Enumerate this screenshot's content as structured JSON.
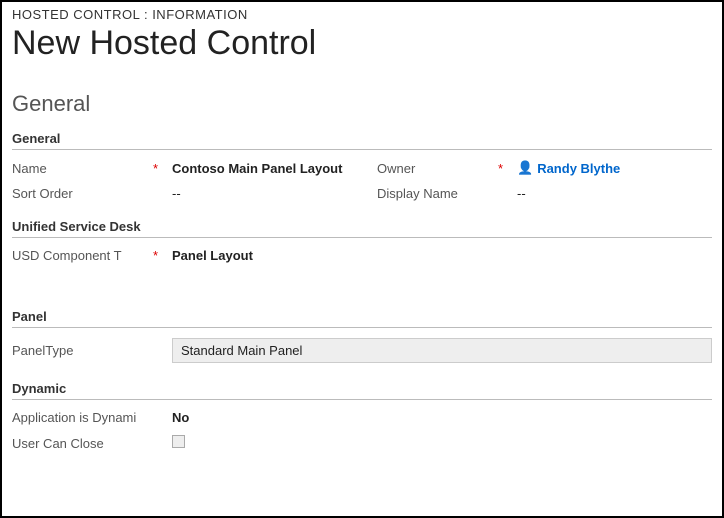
{
  "breadcrumb": "HOSTED CONTROL : INFORMATION",
  "pageTitle": "New Hosted Control",
  "sectionTitle": "General",
  "subsections": {
    "general": "General",
    "usd": "Unified Service Desk",
    "panel": "Panel",
    "dynamic": "Dynamic"
  },
  "fields": {
    "name": {
      "label": "Name",
      "required": "*",
      "value": "Contoso Main Panel Layout"
    },
    "owner": {
      "label": "Owner",
      "required": "*",
      "value": "Randy Blythe"
    },
    "sortOrder": {
      "label": "Sort Order",
      "value": "--"
    },
    "displayName": {
      "label": "Display Name",
      "value": "--"
    },
    "usdComponent": {
      "label": "USD Component T",
      "required": "*",
      "value": "Panel Layout"
    },
    "panelType": {
      "label": "PanelType",
      "value": "Standard Main Panel"
    },
    "appDynamic": {
      "label": "Application is Dynami",
      "value": "No"
    },
    "userCanClose": {
      "label": "User Can Close"
    }
  }
}
